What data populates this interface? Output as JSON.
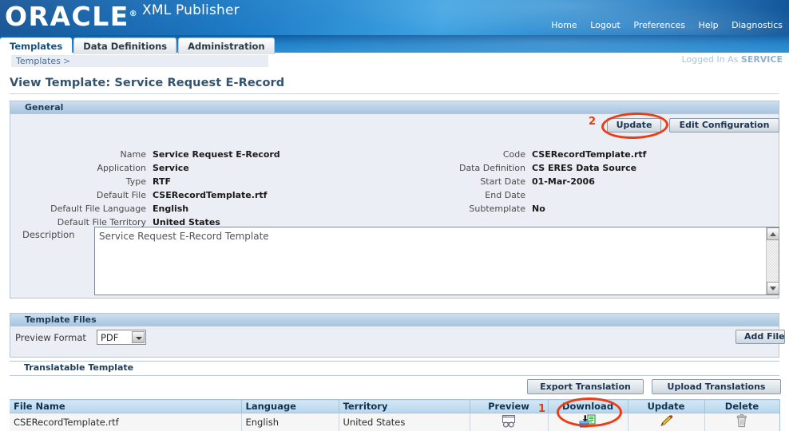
{
  "brand": {
    "logo_text": "ORACLE",
    "logo_reg": "®",
    "app_title": "XML Publisher"
  },
  "globalnav": {
    "items": [
      {
        "label": "Home"
      },
      {
        "label": "Logout"
      },
      {
        "label": "Preferences"
      },
      {
        "label": "Help"
      },
      {
        "label": "Diagnostics"
      }
    ]
  },
  "tabs": [
    {
      "label": "Templates",
      "active": true
    },
    {
      "label": "Data Definitions",
      "active": false
    },
    {
      "label": "Administration",
      "active": false
    }
  ],
  "breadcrumb": {
    "root": "Templates",
    "separator": ">"
  },
  "session": {
    "logged_in_prefix": "Logged In As",
    "user": "SERVICE"
  },
  "page_title": "View Template: Service Request E-Record",
  "general": {
    "header": "General",
    "left_fields": [
      {
        "label": "Name",
        "value": "Service Request E-Record"
      },
      {
        "label": "Application",
        "value": "Service"
      },
      {
        "label": "Type",
        "value": "RTF"
      },
      {
        "label": "Default File",
        "value": "CSERecordTemplate.rtf"
      },
      {
        "label": "Default File Language",
        "value": "English"
      },
      {
        "label": "Default File Territory",
        "value": "United States"
      }
    ],
    "right_fields": [
      {
        "label": "Code",
        "value": "CSERecordTemplate.rtf"
      },
      {
        "label": "Data Definition",
        "value": "CS ERES Data Source"
      },
      {
        "label": "Start Date",
        "value": "01-Mar-2006"
      },
      {
        "label": "End Date",
        "value": ""
      },
      {
        "label": "Subtemplate",
        "value": "No"
      }
    ],
    "update_button": "Update",
    "edit_config_button": "Edit Configuration",
    "description_label": "Description",
    "description_value": "Service Request E-Record Template"
  },
  "template_files": {
    "header": "Template Files",
    "preview_format_label": "Preview Format",
    "preview_format_value": "PDF",
    "add_file_button": "Add File"
  },
  "translatable": {
    "header": "Translatable Template",
    "export_button": "Export Translation",
    "upload_button": "Upload Translations"
  },
  "table": {
    "columns": [
      "File Name",
      "Language",
      "Territory",
      "Preview",
      "Download",
      "Update",
      "Delete"
    ],
    "rows": [
      {
        "file_name": "CSERecordTemplate.rtf",
        "language": "English",
        "territory": "United States",
        "preview_icon": "preview-glasses-icon",
        "download_icon": "download-icon",
        "update_icon": "pencil-icon",
        "delete_icon": "trash-icon"
      }
    ]
  },
  "annotations": [
    {
      "id": "1",
      "label": "1",
      "target": "download-column"
    },
    {
      "id": "2",
      "label": "2",
      "target": "update-button"
    }
  ],
  "colors": {
    "brand_blue": "#1b79c4",
    "annotation_red": "#ef3b12",
    "section_header": "#b7d0e6",
    "table_header": "#c2ddf1"
  }
}
